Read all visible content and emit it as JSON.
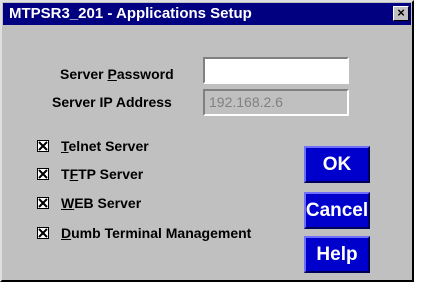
{
  "window": {
    "title": "MTPSR3_201 - Applications Setup",
    "close_glyph": "×"
  },
  "fields": {
    "password_label_pre": "Server ",
    "password_label_u": "P",
    "password_label_post": "assword",
    "password_value": "",
    "ip_label": "Server IP Address",
    "ip_value": "192.168.2.6"
  },
  "checkboxes": [
    {
      "pre": "",
      "u": "T",
      "post": "elnet Server",
      "checked": true
    },
    {
      "pre": "T",
      "u": "F",
      "post": "TP Server",
      "checked": true
    },
    {
      "pre": "",
      "u": "W",
      "post": "EB Server",
      "checked": true
    },
    {
      "pre": "",
      "u": "D",
      "post": "umb Terminal Management",
      "checked": true
    }
  ],
  "buttons": {
    "ok": "OK",
    "cancel": "Cancel",
    "help": "Help"
  },
  "colors": {
    "titlebar": "#000080",
    "button_face": "#0000cc",
    "dialog_face": "#c0c0c0"
  }
}
